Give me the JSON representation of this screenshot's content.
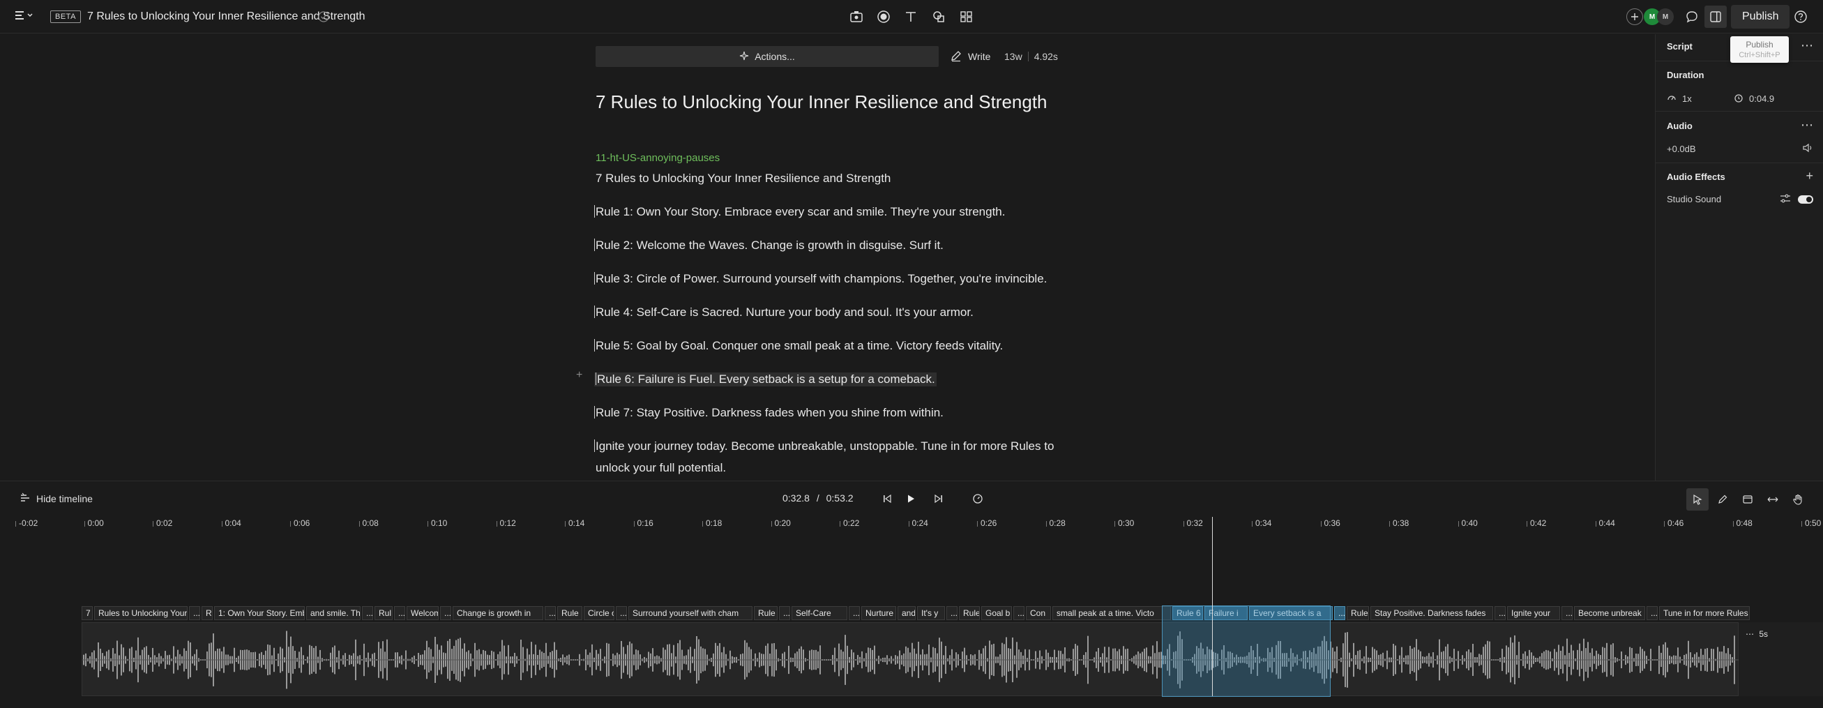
{
  "topbar": {
    "beta": "BETA",
    "title": "7 Rules to Unlocking Your Inner Resilience and Strength",
    "publish": "Publish",
    "avatar_m": "M",
    "avatar_mm": "M"
  },
  "tooltip": {
    "label": "Publish",
    "shortcut": "Ctrl+Shift+P"
  },
  "editor": {
    "actions": "Actions...",
    "write": "Write",
    "words": "13w",
    "duration": "4.92s",
    "title": "7 Rules to Unlocking Your Inner Resilience and Strength",
    "speaker": "11-ht-US-annoying-pauses",
    "paragraphs": [
      "7 Rules to Unlocking Your Inner Resilience and Strength",
      "Rule 1: Own Your Story. Embrace every scar and smile. They're your strength.",
      "Rule 2: Welcome the Waves. Change is growth in disguise. Surf it.",
      "Rule 3: Circle of Power. Surround yourself with champions. Together, you're invincible.",
      "Rule 4: Self-Care is Sacred. Nurture your body and soul. It's your armor.",
      "Rule 5: Goal by Goal. Conquer one small peak at a time. Victory feeds vitality.",
      "Rule 6: Failure is Fuel. Every setback is a setup for a comeback.",
      "Rule 7: Stay Positive. Darkness fades when you shine from within.",
      "Ignite your journey today. Become unbreakable, unstoppable. Tune in for more Rules to",
      "unlock your full potential."
    ]
  },
  "right_panel": {
    "script": "Script",
    "duration_section": "Duration",
    "speed": "1x",
    "time": "0:04.9",
    "audio_section": "Audio",
    "gain": "+0.0dB",
    "effects_section": "Audio Effects",
    "studio_sound": "Studio Sound"
  },
  "timeline": {
    "hide": "Hide timeline",
    "current": "0:32.8",
    "separator": "/",
    "total": "0:53.2",
    "ticks": [
      "-0:02",
      "0:00",
      "0:02",
      "0:04",
      "0:06",
      "0:08",
      "0:10",
      "0:12",
      "0:14",
      "0:16",
      "0:18",
      "0:20",
      "0:22",
      "0:24",
      "0:26",
      "0:28",
      "0:30",
      "0:32",
      "0:34",
      "0:36",
      "0:38",
      "0:40",
      "0:42",
      "0:44",
      "0:46",
      "0:48",
      "0:50"
    ],
    "segments": [
      "7",
      "Rules to Unlocking Your",
      "...",
      "Ru",
      "1: Own Your Story. Emb",
      "and smile. The",
      "...",
      "Rul",
      "...",
      "Welcom",
      "...",
      "Change is growth in",
      "...",
      "Rule",
      "Circle o",
      "...",
      "Surround yourself with cham",
      "Rule",
      "...",
      "Self-Care",
      "...",
      "Nurture",
      "and",
      "It's y",
      "...",
      "Rule",
      "Goal b",
      "...",
      "Con",
      "small peak at a time. Victo",
      "Rule 6",
      "Failure i",
      "Every setback is a",
      "...",
      "Rule",
      "Stay Positive. Darkness fades",
      "...",
      "Ignite your",
      "...",
      "Become unbreak",
      "...",
      "Tune in for more Rules to"
    ],
    "end_label": "5s"
  },
  "colors": {
    "background": "#1b1b1b",
    "speaker": "#6fbf5c",
    "selection": "#2e5f7a",
    "waveform": "#9a9a9a"
  }
}
